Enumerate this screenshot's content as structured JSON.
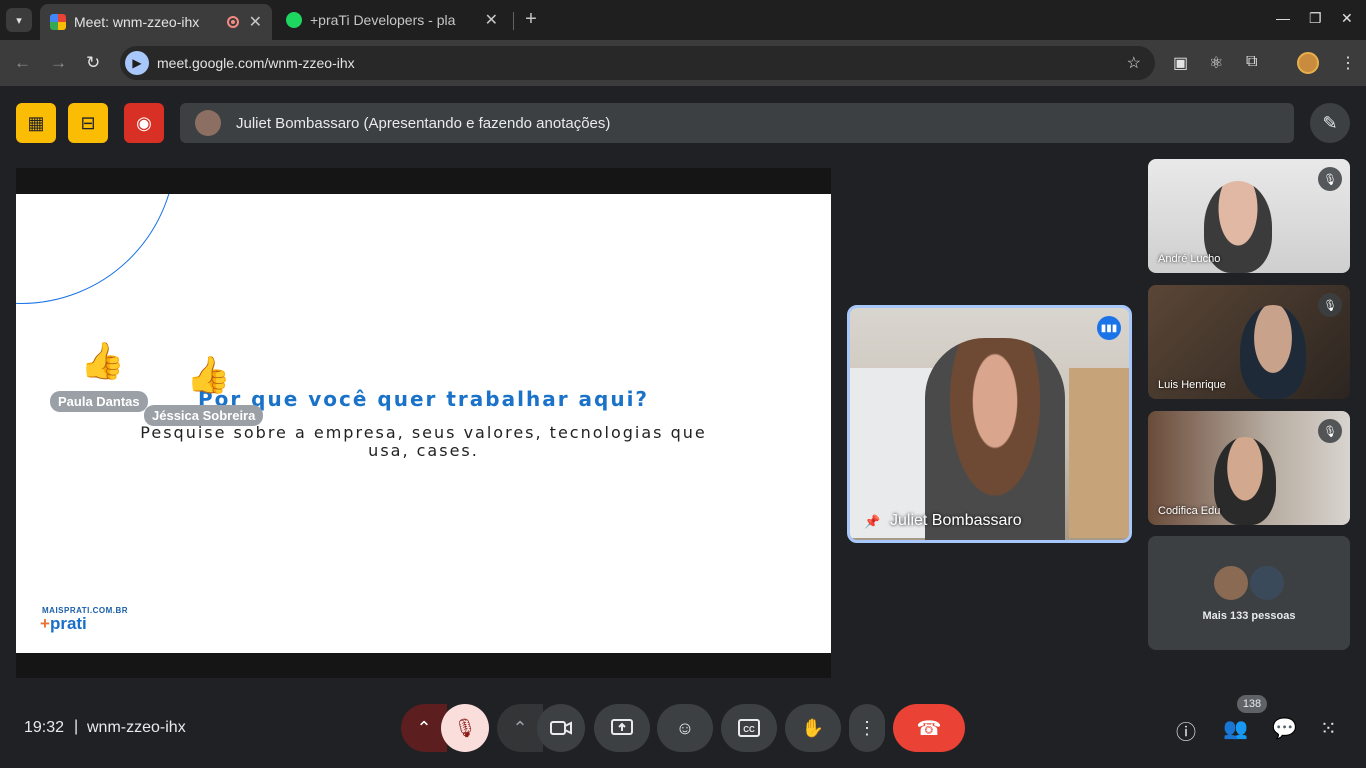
{
  "browser": {
    "tabs": [
      {
        "title": "Meet: wnm-zzeo-ihx",
        "active": true,
        "favicon": "google-meet-icon"
      },
      {
        "title": "+praTi Developers - pla",
        "active": false,
        "favicon": "spotify-icon"
      }
    ],
    "url": "meet.google.com/wnm-zzeo-ihx"
  },
  "meeting": {
    "presenting_label": "Juliet Bombassaro (Apresentando e fazendo anotações)",
    "time": "19:32",
    "separator": "|",
    "code": "wnm-zzeo-ihx",
    "participant_count": "138",
    "colors": {
      "accent": "#a8c7fa",
      "end_call": "#ea4335",
      "host_tool": "#fbbc04",
      "record": "#d93025"
    }
  },
  "slide": {
    "title": "Por que você quer trabalhar aqui?",
    "subtitle": "Pesquise sobre a empresa, seus valores, tecnologias que usa, cases.",
    "logo_top": "MAISPRATI.COM.BR",
    "logo_plus": "+",
    "logo_main": "prati"
  },
  "reactions": [
    {
      "emoji": "👍",
      "name": "Paula Dantas"
    },
    {
      "emoji": "👍",
      "name": "Jéssica Sobreira"
    }
  ],
  "speaker": {
    "name": "Juliet Bombassaro"
  },
  "participants": [
    {
      "name": "André Lucho"
    },
    {
      "name": "Luis Henrique"
    },
    {
      "name": "Codifica Edu"
    }
  ],
  "more_tile": {
    "label": "Mais 133 pessoas"
  }
}
